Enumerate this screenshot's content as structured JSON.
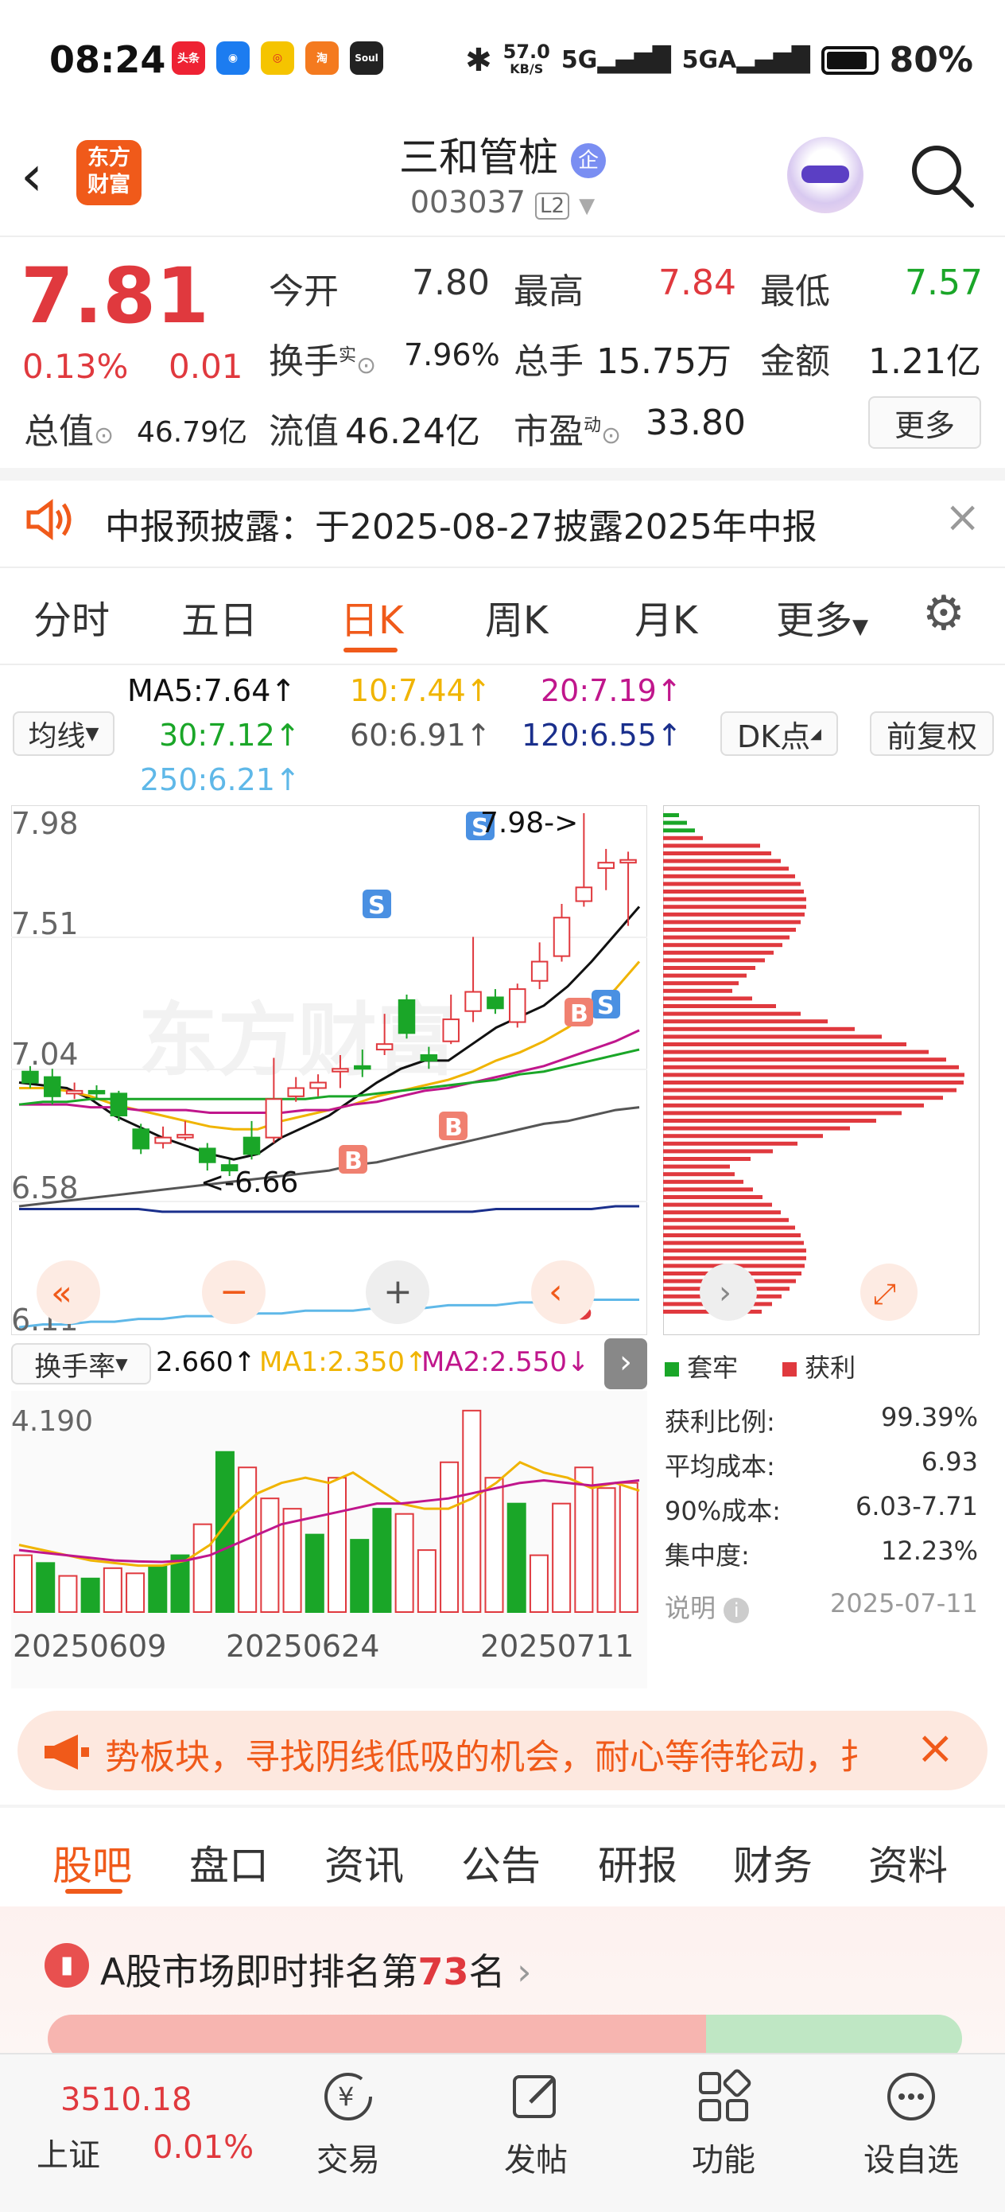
{
  "status_bar": {
    "time": "08:24",
    "net_speed": "57.0",
    "net_unit": "KB/S",
    "battery": "80%",
    "app_icons": [
      "头条",
      "",
      "",
      "淘",
      "Soul"
    ]
  },
  "header": {
    "logo_line1": "东方",
    "logo_line2": "财富",
    "title": "三和管桩",
    "badge": "企",
    "code": "003037",
    "level": "L2"
  },
  "quote": {
    "price": "7.81",
    "change_pct": "0.13%",
    "change": "0.01",
    "open_label": "今开",
    "open": "7.80",
    "high_label": "最高",
    "high": "7.84",
    "low_label": "最低",
    "low": "7.57",
    "turnover_label": "换手",
    "turnover_sup": "实",
    "turnover": "7.96%",
    "volume_label": "总手",
    "volume": "15.75万",
    "amount_label": "金额",
    "amount": "1.21亿",
    "mktcap_label": "总值",
    "mktcap": "46.79亿",
    "float_label": "流值",
    "float_cap": "46.24亿",
    "pe_label": "市盈",
    "pe_sup": "动",
    "pe": "33.80",
    "more_button": "更多"
  },
  "notice": {
    "text": "中报预披露：于2025-08-27披露2025年中报"
  },
  "chart_tabs": [
    "分时",
    "五日",
    "日K",
    "周K",
    "月K",
    "更多"
  ],
  "active_tab": "日K",
  "ma_legend": {
    "ma_button": "均线",
    "ma5": "MA5:7.64↑",
    "ma10": "10:7.44↑",
    "ma20": "20:7.19↑",
    "ma30": "30:7.12↑",
    "ma60": "60:6.91↑",
    "ma120": "120:6.55↑",
    "ma250": "250:6.21↑",
    "dk_button": "DK点",
    "fq_button": "前复权"
  },
  "kline": {
    "y_labels": [
      "7.98",
      "7.51",
      "7.04",
      "6.58",
      "6.11"
    ],
    "high_marker": "7.98->",
    "low_marker": "<-6.66",
    "signal_s": "S",
    "signal_b": "B",
    "watermark": "东方财富"
  },
  "sub_indicator": {
    "button": "换手率",
    "value": "2.660↑",
    "ma1": "MA1:2.350↑",
    "ma2": "MA2:2.550↓",
    "y_label": "4.190",
    "dates": [
      "20250609",
      "20250624",
      "20250711"
    ]
  },
  "chip": {
    "legend_trapped": "套牢",
    "legend_profit": "获利",
    "stats": [
      {
        "label": "获利比例:",
        "value": "99.39%"
      },
      {
        "label": "平均成本:",
        "value": "6.93"
      },
      {
        "label": "90%成本:",
        "value": "6.03-7.71"
      },
      {
        "label": "集中度:",
        "value": "12.23%"
      }
    ],
    "note_label": "说明",
    "date": "2025-07-11"
  },
  "banner": {
    "text": "势板块，寻找阴线低吸的机会，耐心等待轮动，扌"
  },
  "feature_tabs": [
    "股吧",
    "盘口",
    "资讯",
    "公告",
    "研报",
    "财务",
    "资料"
  ],
  "active_feature": "股吧",
  "ranking": {
    "prefix": "A股市场即时排名第",
    "rank": "73",
    "suffix": "名"
  },
  "bottom_nav": {
    "index_value": "3510.18",
    "index_name": "上证",
    "index_change": "0.01%",
    "items": [
      "交易",
      "发帖",
      "功能",
      "设自选"
    ]
  },
  "colors": {
    "up": "#e0393e",
    "down": "#1aa628",
    "accent": "#f05a1a",
    "ma5": "#111111",
    "ma10": "#f0b400",
    "ma20": "#c0168c",
    "ma30": "#1aa628",
    "ma60": "#555555",
    "ma120": "#1a2f8c",
    "ma250": "#5fb8e8"
  }
}
